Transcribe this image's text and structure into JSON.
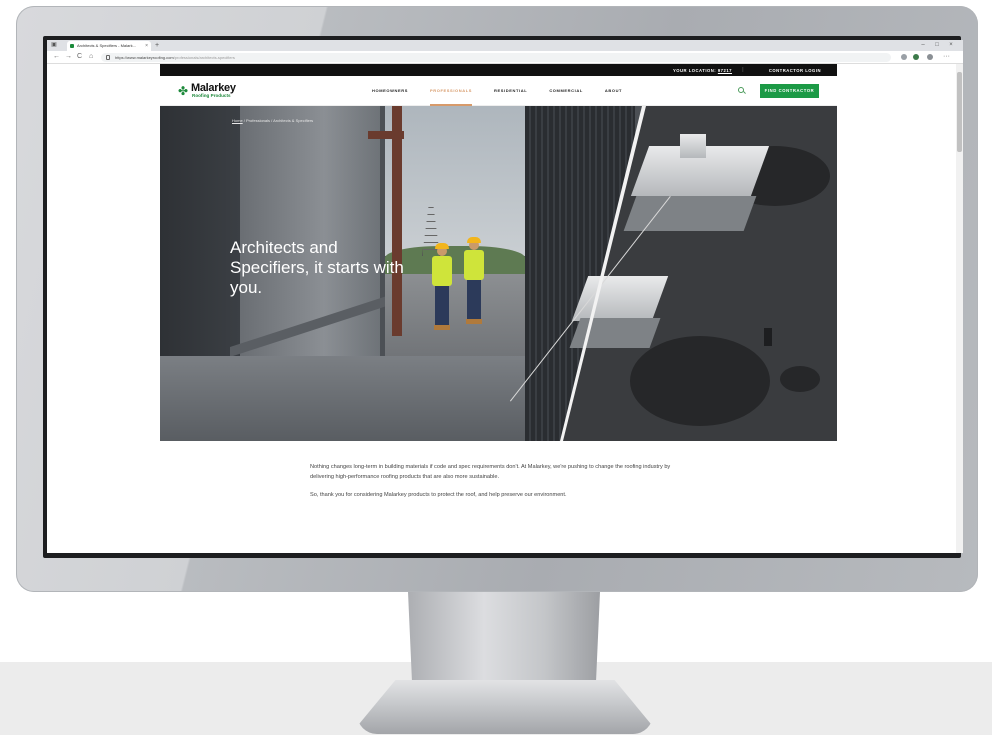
{
  "browser": {
    "tab_title": "Architects & Specifiers - Malark...",
    "tab_close": "×",
    "new_tab": "+",
    "win_min": "–",
    "win_max": "□",
    "win_close": "×",
    "back": "←",
    "forward": "→",
    "reload": "C",
    "home": "⌂",
    "url_host": "https://www.malarkeyroofing.com",
    "url_path": "/professionals/architects-specifiers",
    "menu": "···"
  },
  "utility": {
    "location_label": "YOUR LOCATION:",
    "location_zip": "97217",
    "separator": "|",
    "login": "CONTRACTOR LOGIN"
  },
  "header": {
    "logo_name": "Malarkey",
    "logo_sub": "Roofing Products",
    "nav": [
      "HOMEOWNERS",
      "PROFESSIONALS",
      "RESIDENTIAL",
      "COMMERCIAL",
      "ABOUT"
    ],
    "active_nav": "PROFESSIONALS",
    "find_button": "FIND CONTRACTOR"
  },
  "hero": {
    "breadcrumb_home": "Home",
    "breadcrumb_rest": " / Professionals / Architects & Specifiers",
    "title": "Architects and Specifiers, it starts with you."
  },
  "intro": {
    "p1": "Nothing changes long-term in building materials if code and spec requirements don't. At Malarkey, we're pushing to change the roofing industry by delivering high-performance roofing products that are also more sustainable.",
    "p2": "So, thank you for considering Malarkey products to protect the roof, and help preserve our environment."
  },
  "colors": {
    "brand_green": "#1c9a46",
    "active_nav": "#d79a6a",
    "utility_bar": "#111111"
  }
}
